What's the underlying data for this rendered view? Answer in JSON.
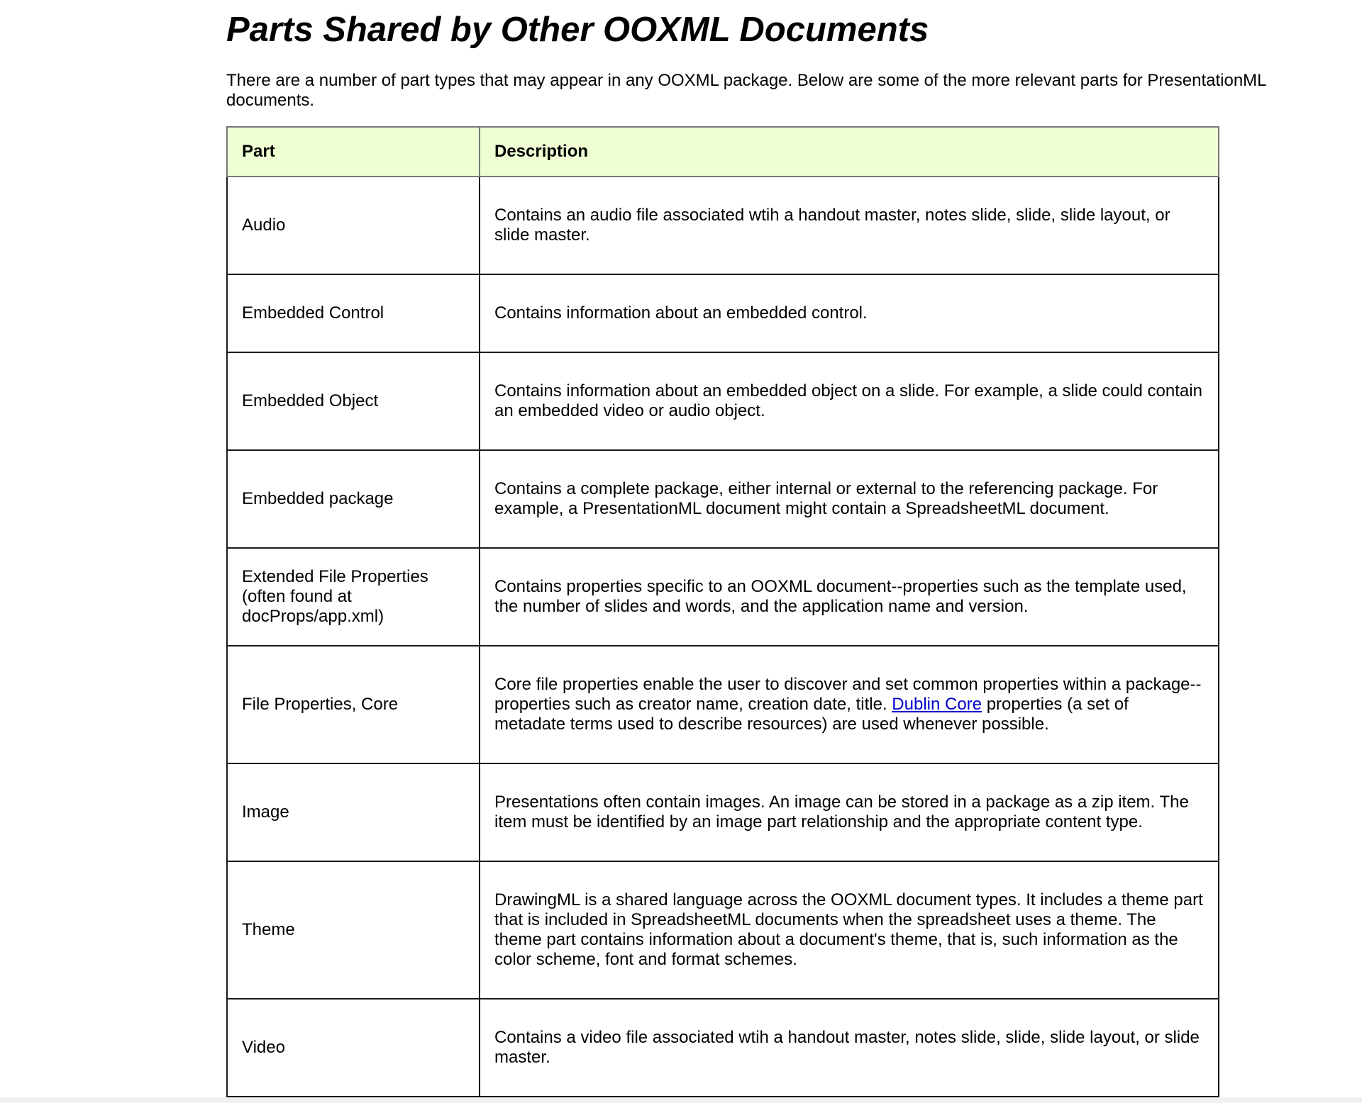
{
  "heading": "Parts Shared by Other OOXML Documents",
  "intro": "There are a number of part types that may appear in any OOXML package. Below are some of the more relevant parts for PresentationML documents.",
  "table": {
    "headers": {
      "part": "Part",
      "description": "Description"
    },
    "rows": [
      {
        "part": "Audio",
        "description": "Contains an audio file associated wtih a handout master, notes slide, slide, slide layout, or slide master."
      },
      {
        "part": "Embedded Control",
        "description": "Contains information about an embedded control."
      },
      {
        "part": "Embedded Object",
        "description": "Contains information about an embedded object on a slide. For example, a slide could contain an embedded video or audio object."
      },
      {
        "part": "Embedded package",
        "description": "Contains a complete package, either internal or external to the referencing package. For example, a PresentationML document might contain a SpreadsheetML document."
      },
      {
        "part": "Extended File Properties (often found at docProps/app.xml)",
        "description": "Contains properties specific to an OOXML document--properties such as the template used, the number of slides and words, and the application name and version."
      },
      {
        "part": "File Properties, Core",
        "description_before": "Core file properties enable the user to discover and set common properties within a package--properties such as creator name, creation date, title.",
        "description_link": "Dublin Core",
        "description_after": "properties (a set of metadate terms used to describe resources) are used whenever possible."
      },
      {
        "part": "Image",
        "description": "Presentations often contain images. An image can be stored in a package as a zip item. The item must be identified by an image part relationship and the appropriate content type."
      },
      {
        "part": "Theme",
        "description": "DrawingML is a shared language across the OOXML document types. It includes a theme part that is included in SpreadsheetML documents when the spreadsheet uses a theme. The theme part contains information about a document's theme, that is, such information as the color scheme, font and format schemes."
      },
      {
        "part": "Video",
        "description": "Contains a video file associated wtih a handout master, notes slide, slide, slide layout, or slide master."
      }
    ]
  },
  "colors": {
    "header_bg": "#eeffd3",
    "link": "#0000cc",
    "border": "#1a1a1a"
  }
}
